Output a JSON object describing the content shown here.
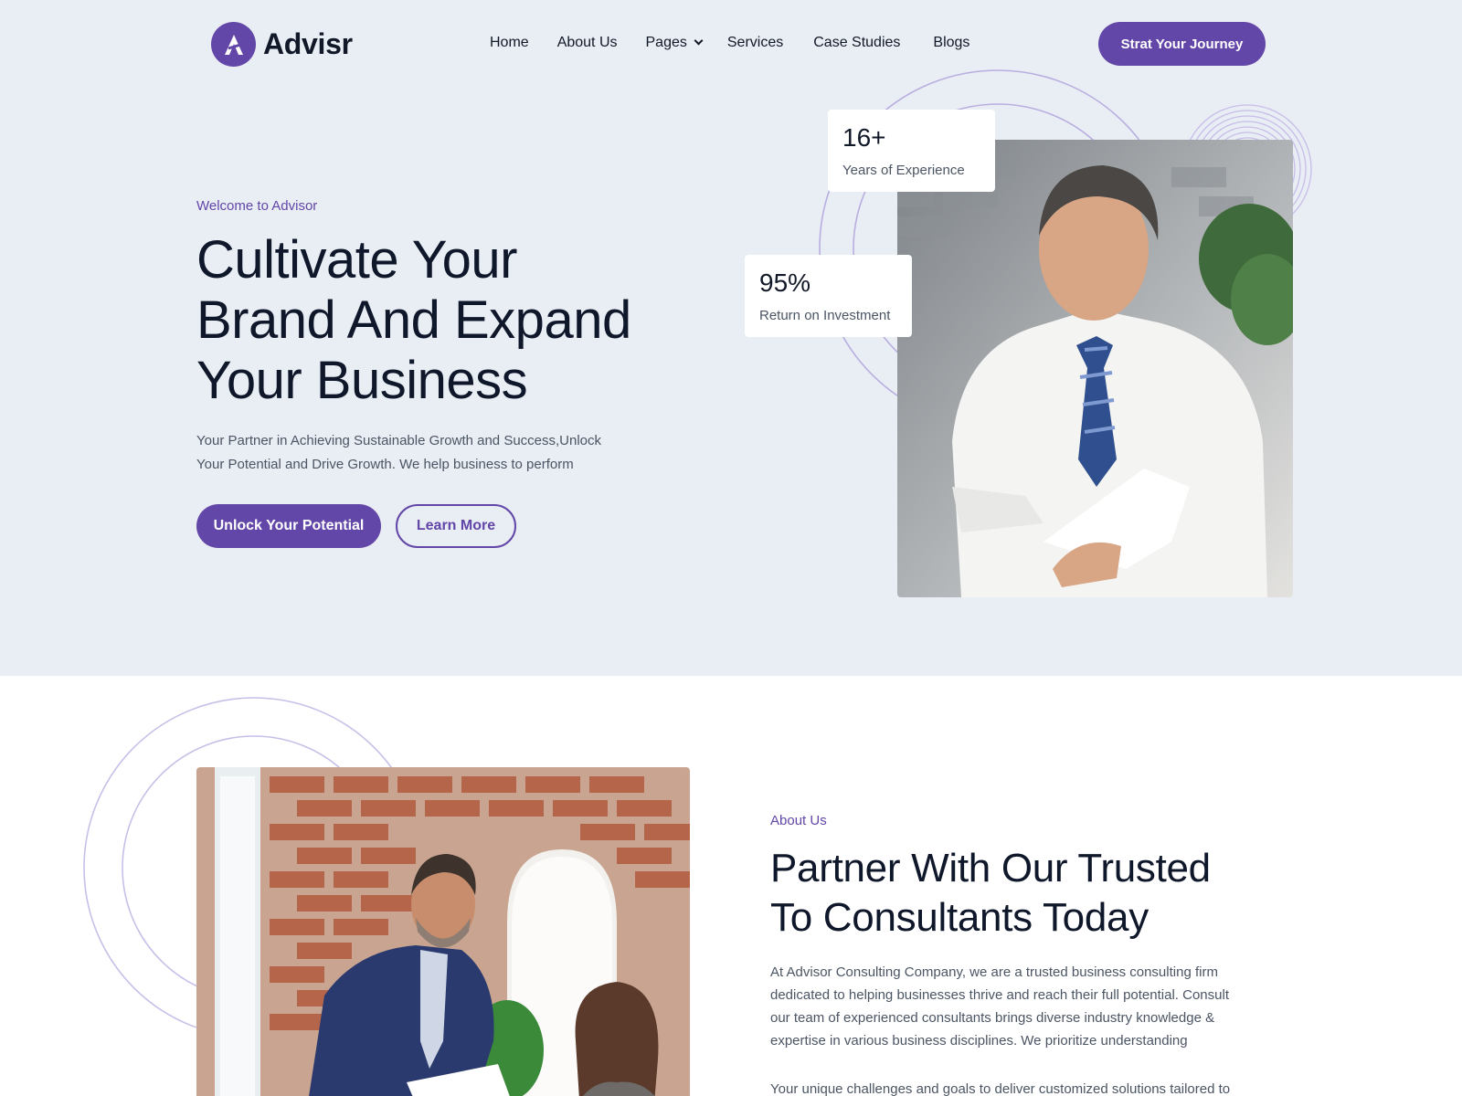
{
  "brand": {
    "name": "Advisr",
    "accent": "#6246a8"
  },
  "nav": {
    "items": [
      {
        "label": "Home"
      },
      {
        "label": "About Us"
      },
      {
        "label": "Pages",
        "has_dropdown": true
      },
      {
        "label": "Services"
      },
      {
        "label": "Case Studies"
      },
      {
        "label": "Blogs"
      }
    ],
    "cta": "Strat Your Journey"
  },
  "hero": {
    "eyebrow": "Welcome to  Advisor",
    "title_lines": [
      "Cultivate Your",
      "Brand And Expand",
      "Your Business"
    ],
    "desc_lines": [
      "Your Partner in Achieving Sustainable Growth and Success,Unlock",
      "Your Potential and Drive Growth. We help business to perform"
    ],
    "primary_button": "Unlock Your Potential",
    "secondary_button": "Learn More",
    "stats": [
      {
        "value": "16+",
        "label": "Years of Experience"
      },
      {
        "value": "95%",
        "label": "Return on Investment"
      }
    ]
  },
  "about": {
    "eyebrow": "About Us",
    "title_lines": [
      "Partner With Our Trusted",
      "To Consultants Today"
    ],
    "desc_lines": [
      "At Advisor Consulting Company, we are a trusted business consulting firm",
      "dedicated to helping businesses thrive and reach their full potential. Consult",
      "our team of experienced consultants brings diverse industry knowledge &",
      "expertise in various business disciplines. We prioritize understanding"
    ],
    "desc_2": "Your unique challenges and goals to deliver customized solutions tailored to"
  }
}
